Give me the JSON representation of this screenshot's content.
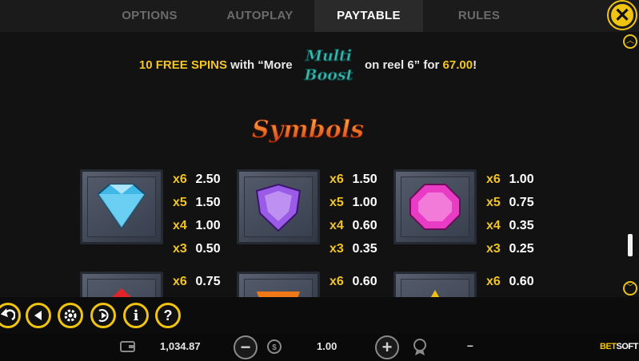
{
  "tabs": [
    {
      "label": "OPTIONS",
      "active": false
    },
    {
      "label": "AUTOPLAY",
      "active": false
    },
    {
      "label": "PAYTABLE",
      "active": true
    },
    {
      "label": "RULES",
      "active": false
    }
  ],
  "close_icon": "close-icon",
  "promo": {
    "part1": "10 FREE SPINS",
    "part2": " with “More ",
    "logo_text": "Multi Boost",
    "part3": " on reel 6” for ",
    "price": "67.00",
    "part4": "!"
  },
  "symbols_title": "Symbols",
  "symbols": [
    {
      "name": "blue-diamond",
      "color": "#3fb8e8",
      "pays": [
        {
          "m": "x6",
          "v": "2.50"
        },
        {
          "m": "x5",
          "v": "1.50"
        },
        {
          "m": "x4",
          "v": "1.00"
        },
        {
          "m": "x3",
          "v": "0.50"
        }
      ]
    },
    {
      "name": "purple-gem",
      "color": "#9a5be6",
      "pays": [
        {
          "m": "x6",
          "v": "1.50"
        },
        {
          "m": "x5",
          "v": "1.00"
        },
        {
          "m": "x4",
          "v": "0.60"
        },
        {
          "m": "x3",
          "v": "0.35"
        }
      ]
    },
    {
      "name": "pink-gem",
      "color": "#e83cc4",
      "pays": [
        {
          "m": "x6",
          "v": "1.00"
        },
        {
          "m": "x5",
          "v": "0.75"
        },
        {
          "m": "x4",
          "v": "0.35"
        },
        {
          "m": "x3",
          "v": "0.25"
        }
      ]
    },
    {
      "name": "red-gem",
      "color": "#e0242a",
      "pays": [
        {
          "m": "x6",
          "v": "0.75"
        }
      ]
    },
    {
      "name": "orange-gem",
      "color": "#f07818",
      "pays": [
        {
          "m": "x6",
          "v": "0.60"
        }
      ]
    },
    {
      "name": "yellow-gem",
      "color": "#f0c018",
      "pays": [
        {
          "m": "x6",
          "v": "0.60"
        }
      ]
    }
  ],
  "controls": [
    "back-icon",
    "rewind-icon",
    "settings-icon",
    "play-icon",
    "info-icon",
    "help-icon"
  ],
  "control_glyphs": {
    "info": "i",
    "help": "?"
  },
  "status": {
    "balance": "1,034.87",
    "bet": "1.00",
    "win": "–",
    "brand_part1": "BET",
    "brand_part2": "SOFT"
  },
  "colors": {
    "accent": "#f1c40f",
    "background": "#121212"
  }
}
